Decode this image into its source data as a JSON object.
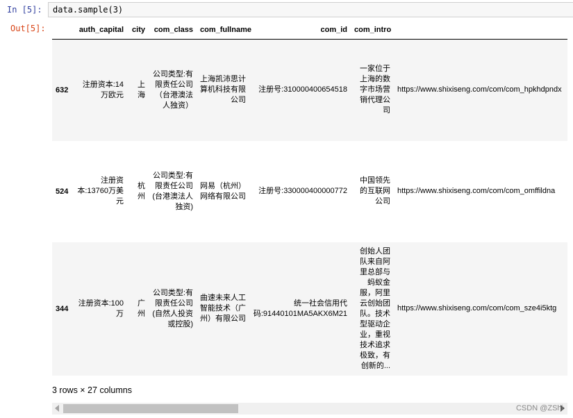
{
  "cell": {
    "in_prompt": "In [5]:",
    "out_prompt": "Out[5]:",
    "code": "data.sample(3)"
  },
  "dataframe": {
    "columns": [
      "",
      "auth_capital",
      "city",
      "com_class",
      "com_fullname",
      "com_id",
      "com_intro",
      "com_li"
    ],
    "rows": [
      {
        "index": "632",
        "auth_capital": "注册资本:14万欧元",
        "city": "上海",
        "com_class": "公司类型:有限责任公司（台港澳法人独资）",
        "com_fullname": "上海凯沛思计算机科技有限公司",
        "com_id": "注册号:310000400654518",
        "com_intro": "一家位于上海的数字市场营销代理公司",
        "com_link": "https://www.shixiseng.com/com/com_hpkhdpndx"
      },
      {
        "index": "524",
        "auth_capital": "注册资本:13760万美元",
        "city": "杭州",
        "com_class": "公司类型:有限责任公司(台港澳法人独资)",
        "com_fullname": "网易（杭州）网络有限公司",
        "com_id": "注册号:330000400000772",
        "com_intro": "中国领先的互联网公司",
        "com_link": "https://www.shixiseng.com/com/com_omffildna"
      },
      {
        "index": "344",
        "auth_capital": "注册资本:100万",
        "city": "广州",
        "com_class": "公司类型:有限责任公司(自然人投资或控股)",
        "com_fullname": "曲速未来人工智能技术（广州）有限公司",
        "com_id": "统一社会信用代码:91440101MA5AKX6M21",
        "com_intro": "创始人团队来自阿里总部与蚂蚁金服，阿里云创始团队。技术型驱动企业，重视技术追求极致，有创新的...",
        "com_link": "https://www.shixiseng.com/com/com_sze4i5ktg"
      }
    ],
    "shape_text": "3 rows × 27 columns"
  },
  "watermark": "CSDN @ZShi"
}
